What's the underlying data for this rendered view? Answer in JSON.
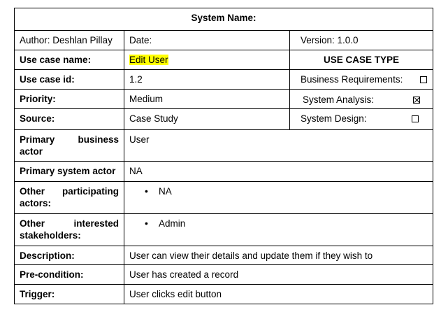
{
  "title": "System Name:",
  "author": "Author: Deshlan Pillay",
  "date_label": "Date:",
  "version": "Version: 1.0.0",
  "use_case_name": {
    "label": "Use case name:",
    "value": "Edit User"
  },
  "use_case_type_heading": "USE CASE TYPE",
  "use_case_id": {
    "label": "Use case id:",
    "value": "1.2"
  },
  "priority": {
    "label": "Priority:",
    "value": "Medium"
  },
  "source": {
    "label": "Source:",
    "value": "Case Study"
  },
  "use_case_types": [
    {
      "label": "Business Requirements:",
      "checked": false
    },
    {
      "label": "System Analysis:",
      "checked": true
    },
    {
      "label": "System Design:",
      "checked": false
    }
  ],
  "primary_business_actor": {
    "label": "Primary business actor",
    "value": "User"
  },
  "primary_system_actor": {
    "label": "Primary system actor",
    "value": "NA"
  },
  "other_participating_actors": {
    "label": "Other participating actors:",
    "items": [
      "NA"
    ]
  },
  "other_interested_stakeholders": {
    "label": "Other interested stakeholders:",
    "items": [
      "Admin"
    ]
  },
  "description": {
    "label": "Description:",
    "value": "User can view their details and update them if they wish to"
  },
  "pre_condition": {
    "label": "Pre-condition:",
    "value": "User has created a record"
  },
  "trigger": {
    "label": "Trigger:",
    "value": "User clicks edit button"
  }
}
